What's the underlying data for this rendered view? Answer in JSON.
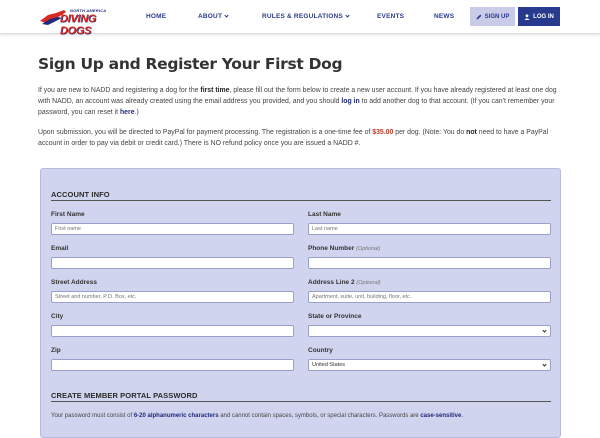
{
  "brand": {
    "small": "NORTH AMERICA",
    "big": "DIVING DOGS"
  },
  "nav": {
    "home": "HOME",
    "about": "ABOUT",
    "rules": "RULES & REGULATIONS",
    "events": "EVENTS",
    "news": "NEWS",
    "signup": "SIGN UP",
    "login": "LOG IN"
  },
  "page": {
    "title": "Sign Up and Register Your First Dog",
    "intro": {
      "t1": "If you are new to NADD and registering a dog for the ",
      "b1": "first time",
      "t2": ", please fill out the form below to create a new user account. If you have already registered at least one dog with NADD, an account was already created using the email address you provided, and you should ",
      "link1": "log in",
      "t3": " to add another dog to that account. (If you can't remember your password, you can reset it ",
      "link2": "here",
      "t4": ".)"
    },
    "payment": {
      "t1": "Upon submission, you will be directed to PayPal for payment processing. The registration is a one-time fee of ",
      "fee": "$35.00",
      "t2": " per dog. (Note: You do ",
      "b1": "not",
      "t3": " need to have a PayPal account in order to pay via debit or credit card.) There is NO refund policy once you are issued a NADD #."
    }
  },
  "form": {
    "account_heading": "ACCOUNT INFO",
    "first_name": {
      "label": "First Name",
      "placeholder": "First name"
    },
    "last_name": {
      "label": "Last Name",
      "placeholder": "Last name"
    },
    "email": {
      "label": "Email"
    },
    "phone": {
      "label": "Phone Number",
      "optional": "(Optional)"
    },
    "street": {
      "label": "Street Address",
      "placeholder": "Street and number, P.O. Box, etc."
    },
    "address2": {
      "label": "Address Line 2",
      "optional": "(Optional)",
      "placeholder": "Apartment, suite, unit, building, floor, etc."
    },
    "city": {
      "label": "City"
    },
    "state": {
      "label": "State or Province",
      "value": ""
    },
    "zip": {
      "label": "Zip"
    },
    "country": {
      "label": "Country",
      "value": "United States"
    },
    "password_heading": "CREATE MEMBER PORTAL PASSWORD",
    "password_note": {
      "t1": "Your password must consist of ",
      "b1": "6-20 alphanumeric characters",
      "t2": " and cannot contain spaces, symbols, or special characters. Passwords are ",
      "b2": "case-sensitive",
      "t3": "."
    }
  }
}
